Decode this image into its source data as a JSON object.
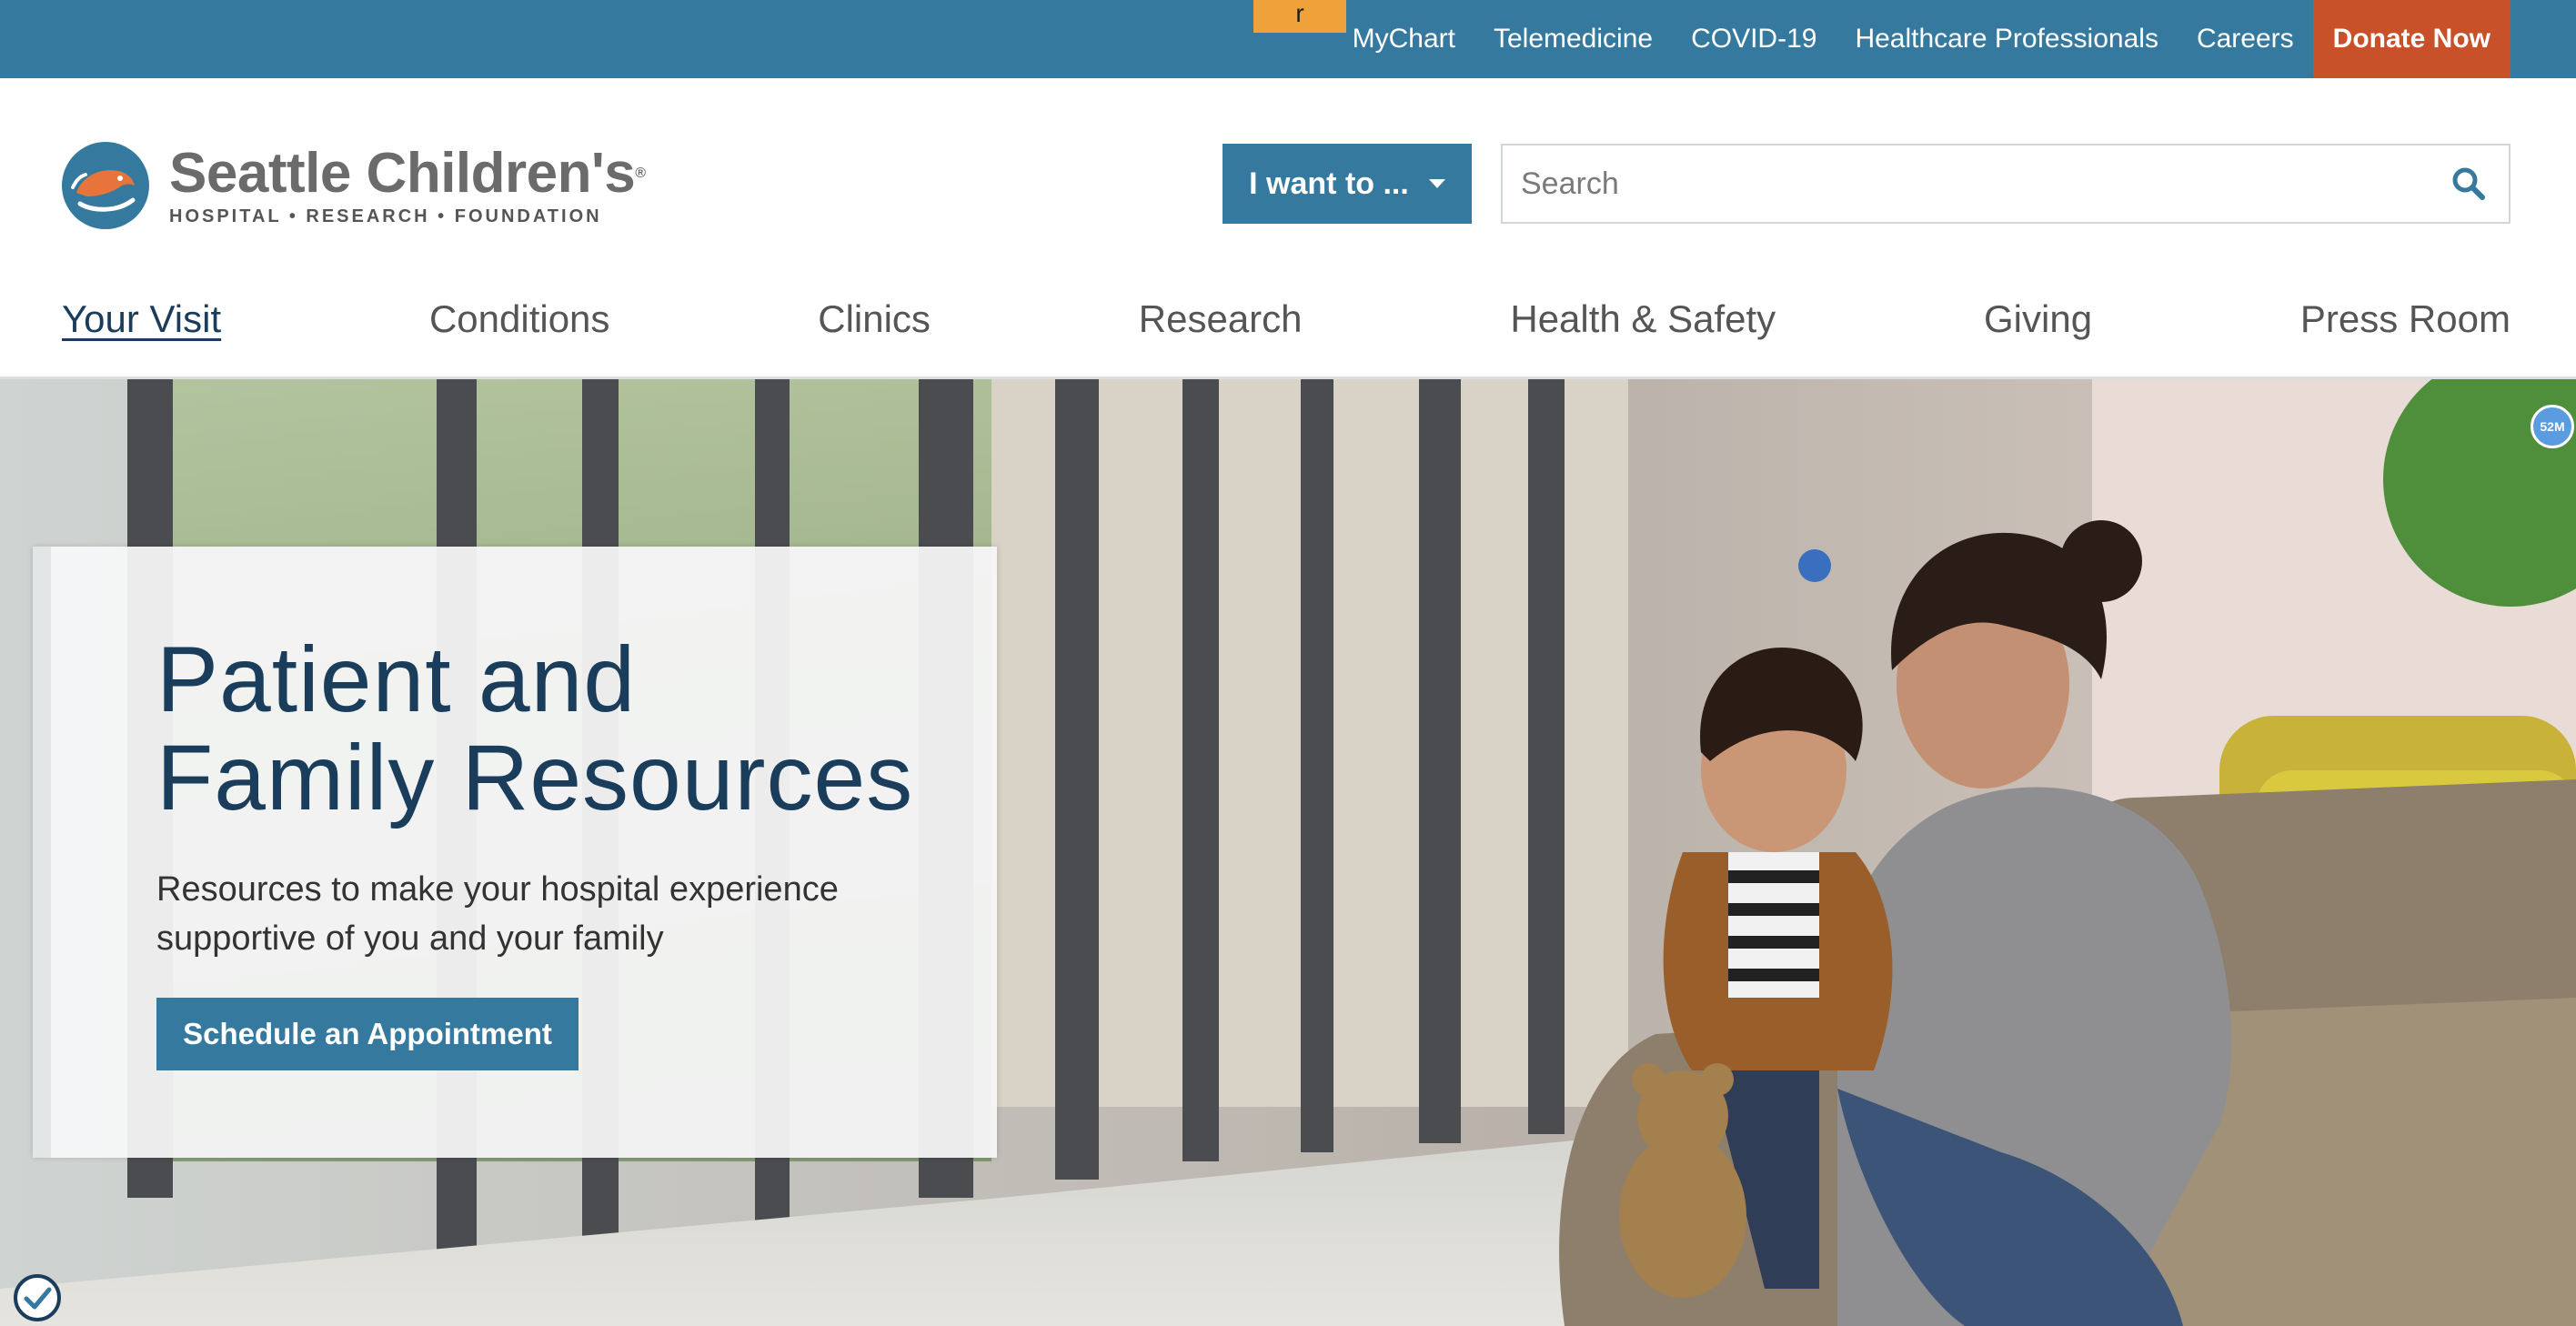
{
  "utility_bar": {
    "skip_label": "r",
    "links": [
      "MyChart",
      "Telemedicine",
      "COVID-19",
      "Healthcare Professionals",
      "Careers"
    ],
    "donate_label": "Donate Now",
    "colors": {
      "bar": "#357a9e",
      "donate": "#c8512a",
      "skip_tab": "#f0a23a"
    }
  },
  "header": {
    "logo_name": "Seattle Children's",
    "logo_registered": "®",
    "logo_tagline": "HOSPITAL • RESEARCH • FOUNDATION",
    "logo_icon": "whale-icon",
    "i_want_to_label": "I want to ...",
    "search_placeholder": "Search"
  },
  "main_nav": {
    "items": [
      "Your Visit",
      "Conditions",
      "Clinics",
      "Research",
      "Health & Safety",
      "Giving",
      "Press Room"
    ],
    "active": "Your Visit"
  },
  "hero": {
    "title_line1": "Patient and",
    "title_line2": "Family Resources",
    "subtitle_line1": "Resources to make your hospital experience",
    "subtitle_line2": "supportive of you and your family",
    "cta_label": "Schedule an Appointment",
    "photo": "mother-and-child-on-bench-photo"
  },
  "overlay": {
    "badge_label": "52M",
    "accessibility_icon": "check-shield-icon"
  }
}
